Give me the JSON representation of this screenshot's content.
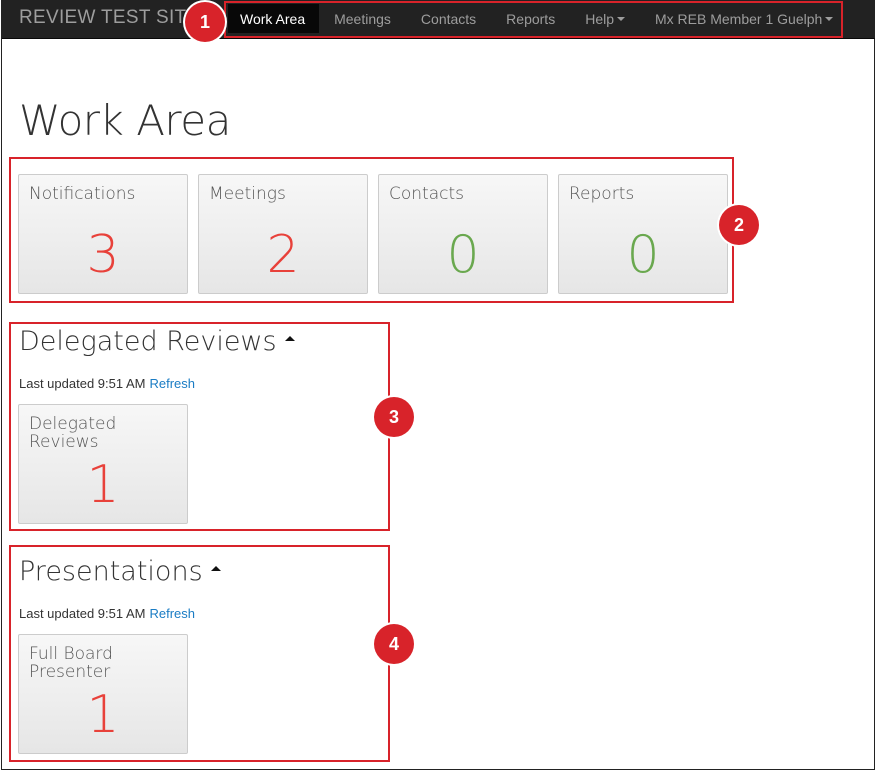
{
  "app": {
    "brand": "REVIEW TEST SITE"
  },
  "nav": {
    "items": [
      {
        "label": "Work Area",
        "active": true
      },
      {
        "label": "Meetings"
      },
      {
        "label": "Contacts"
      },
      {
        "label": "Reports"
      },
      {
        "label": "Help"
      },
      {
        "label": "Mx REB Member 1 Guelph"
      }
    ]
  },
  "page": {
    "title": "Work Area"
  },
  "summary_tiles": [
    {
      "label": "Notifications",
      "count": "3",
      "color": "#e8413a"
    },
    {
      "label": "Meetings",
      "count": "2",
      "color": "#e8413a"
    },
    {
      "label": "Contacts",
      "count": "0",
      "color": "#6aa84f"
    },
    {
      "label": "Reports",
      "count": "0",
      "color": "#6aa84f"
    }
  ],
  "delegated": {
    "title": "Delegated Reviews",
    "updated_text": "Last updated 9:51 AM",
    "refresh_label": "Refresh",
    "tile": {
      "label": "Delegated Reviews",
      "count": "1",
      "color": "#e8413a"
    }
  },
  "presentations": {
    "title": "Presentations",
    "updated_text": "Last updated 9:51 AM",
    "refresh_label": "Refresh",
    "tile": {
      "label": "Full Board Presenter",
      "count": "1",
      "color": "#e8413a"
    }
  },
  "annotations": [
    "1",
    "2",
    "3",
    "4"
  ],
  "colors": {
    "annotation": "#d8232a",
    "navbar": "#222222",
    "link": "#1a7cc4"
  }
}
